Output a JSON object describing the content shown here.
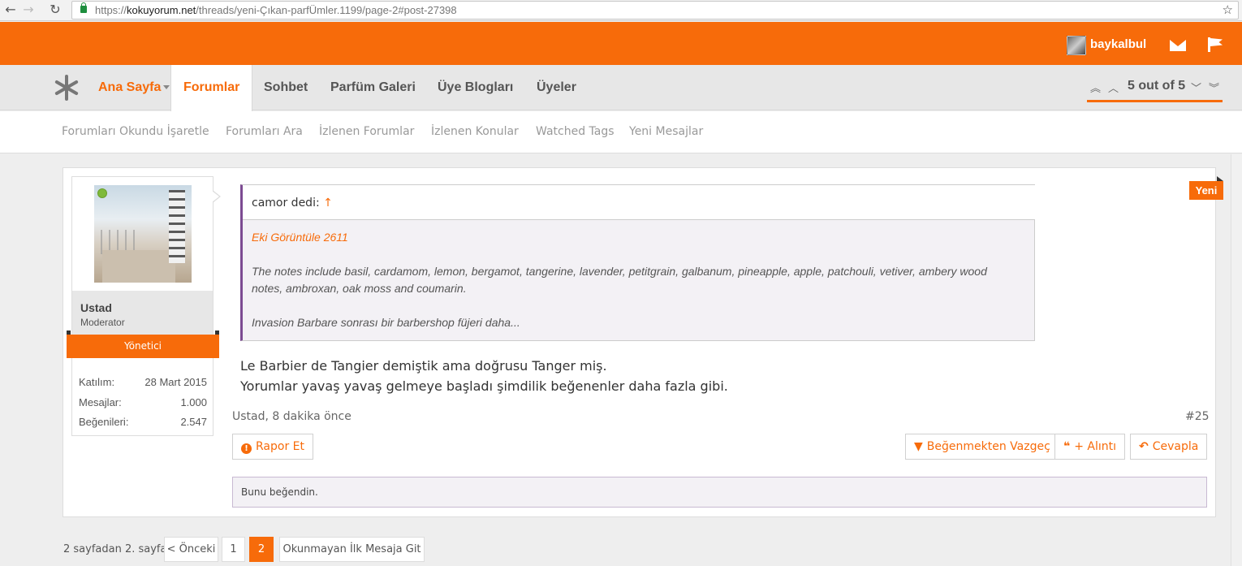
{
  "browser": {
    "url_prefix": "https://",
    "url_host": "kokuyorum.net",
    "url_path": "/threads/yeni-Çıkan-parfÜmler.1199/page-2#post-27398",
    "back_icon": "arrow-left-icon",
    "forward_icon": "arrow-right-icon",
    "reload_icon": "reload-icon"
  },
  "header": {
    "username": "baykalbul",
    "accent_color": "#f76b0a"
  },
  "nav": {
    "home": "Ana Sayfa",
    "forums": "Forumlar",
    "chat": "Sohbet",
    "gallery": "Parfüm Galeri",
    "blogs": "Üye Blogları",
    "members": "Üyeler",
    "page_indicator": "5 out of 5"
  },
  "subnav": {
    "items": [
      "Forumları Okundu İşaretle",
      "Forumları Ara",
      "İzlenen Forumlar",
      "İzlenen Konular",
      "Watched Tags",
      "Yeni Mesajlar"
    ]
  },
  "post": {
    "author": {
      "name": "Ustad",
      "title": "Moderator",
      "role": "Yönetici",
      "stats": [
        {
          "label": "Katılım:",
          "value": "28 Mart 2015"
        },
        {
          "label": "Mesajlar:",
          "value": "1.000"
        },
        {
          "label": "Beğenileri:",
          "value": "2.547"
        }
      ]
    },
    "badge": "Yeni",
    "quote": {
      "attribution": "camor dedi:",
      "arrow": "↑",
      "attachment_link": "Eki Görüntüle 2611",
      "line1": "The notes include basil, cardamom, lemon, bergamot, tangerine, lavender, petitgrain, galbanum, pineapple, apple, patchouli, vetiver, ambery wood",
      "line2": "notes, ambroxan, oak moss and coumarin.",
      "line3": "Invasion Barbare sonrası bir barbershop füjeri daha..."
    },
    "message": {
      "line1": "Le Barbier de Tangier demiştik ama doğrusu Tanger miş.",
      "line2": "Yorumlar yavaş yavaş gelmeye başladı şimdilik beğenenler daha fazla gibi."
    },
    "meta": "Ustad, 8 dakika önce",
    "number": "#25",
    "actions": {
      "report": "Rapor Et",
      "unlike": "Beğenmekten Vazgeç",
      "quote": "+ Alıntı",
      "reply": "Cevapla"
    },
    "likes_text": "Bunu beğendin."
  },
  "pagination": {
    "summary": "2 sayfadan 2. sayfa",
    "prev": "< Önceki",
    "page1": "1",
    "page2": "2",
    "first_unread": "Okunmayan İlk Mesaja Git"
  }
}
